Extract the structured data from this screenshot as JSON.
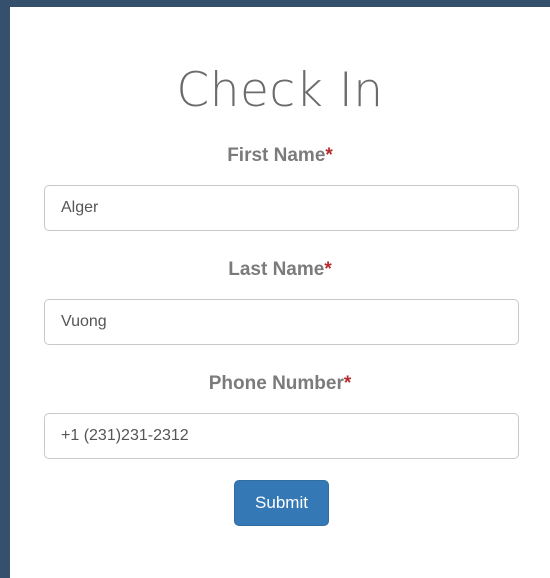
{
  "form": {
    "title": "Check In",
    "required_marker": "*",
    "fields": [
      {
        "label": "First Name",
        "value": "Alger"
      },
      {
        "label": "Last Name",
        "value": "Vuong"
      },
      {
        "label": "Phone Number",
        "value": "+1 (231)231-2312"
      }
    ],
    "submit_label": "Submit"
  },
  "colors": {
    "page_background": "#34506c",
    "card_background": "#ffffff",
    "label_text": "#7b7b7b",
    "required_marker": "#b52a2a",
    "primary_button": "#3479b5"
  }
}
